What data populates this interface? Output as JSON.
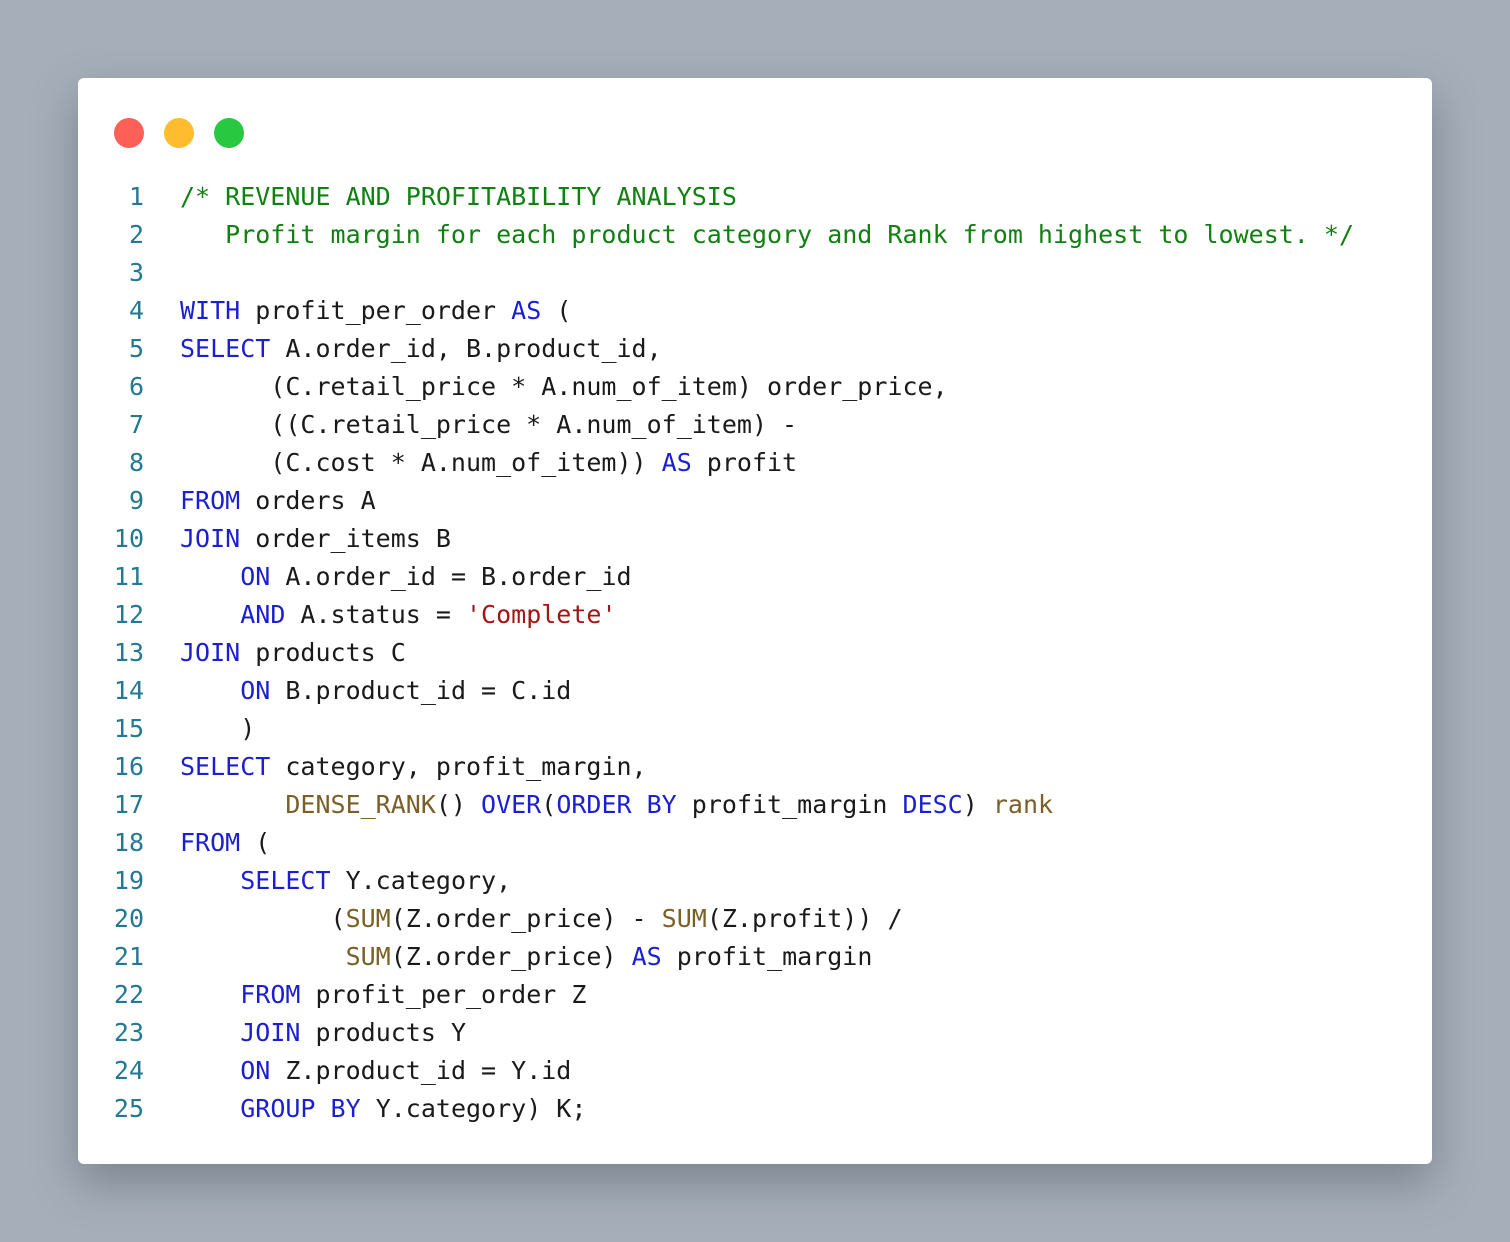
{
  "window": {
    "controls": [
      {
        "name": "close",
        "color": "#fe5f57"
      },
      {
        "name": "minimize",
        "color": "#febc2e"
      },
      {
        "name": "zoom",
        "color": "#28c840"
      }
    ]
  },
  "colors": {
    "background": "#a6afb9",
    "comment": "#108010",
    "keyword": "#1b1fd0",
    "function": "#7a5f27",
    "string": "#a31515",
    "text": "#1a1a1a",
    "line_number": "#237893"
  },
  "code": {
    "lines": [
      {
        "number": "1",
        "tokens": [
          {
            "t": "/* REVENUE AND PROFITABILITY ANALYSIS",
            "k": "com"
          }
        ]
      },
      {
        "number": "2",
        "tokens": [
          {
            "t": "   Profit margin for each product category and Rank from highest to lowest. */",
            "k": "com"
          }
        ]
      },
      {
        "number": "3",
        "tokens": []
      },
      {
        "number": "4",
        "tokens": [
          {
            "t": "WITH",
            "k": "kw"
          },
          {
            "t": " profit_per_order ",
            "k": "txt"
          },
          {
            "t": "AS",
            "k": "kw"
          },
          {
            "t": " (",
            "k": "txt"
          }
        ]
      },
      {
        "number": "5",
        "tokens": [
          {
            "t": "SELECT",
            "k": "kw"
          },
          {
            "t": " A.order_id, B.product_id,",
            "k": "txt"
          }
        ]
      },
      {
        "number": "6",
        "tokens": [
          {
            "t": "      (C.retail_price * A.num_of_item) order_price,",
            "k": "txt"
          }
        ]
      },
      {
        "number": "7",
        "tokens": [
          {
            "t": "      ((C.retail_price * A.num_of_item) -",
            "k": "txt"
          }
        ]
      },
      {
        "number": "8",
        "tokens": [
          {
            "t": "      (C.cost * A.num_of_item)) ",
            "k": "txt"
          },
          {
            "t": "AS",
            "k": "kw"
          },
          {
            "t": " profit",
            "k": "txt"
          }
        ]
      },
      {
        "number": "9",
        "tokens": [
          {
            "t": "FROM",
            "k": "kw"
          },
          {
            "t": " orders A",
            "k": "txt"
          }
        ]
      },
      {
        "number": "10",
        "tokens": [
          {
            "t": "JOIN",
            "k": "kw"
          },
          {
            "t": " order_items B",
            "k": "txt"
          }
        ]
      },
      {
        "number": "11",
        "tokens": [
          {
            "t": "    ",
            "k": "txt"
          },
          {
            "t": "ON",
            "k": "kw"
          },
          {
            "t": " A.order_id = B.order_id",
            "k": "txt"
          }
        ]
      },
      {
        "number": "12",
        "tokens": [
          {
            "t": "    ",
            "k": "txt"
          },
          {
            "t": "AND",
            "k": "kw"
          },
          {
            "t": " A.status = ",
            "k": "txt"
          },
          {
            "t": "'Complete'",
            "k": "str"
          }
        ]
      },
      {
        "number": "13",
        "tokens": [
          {
            "t": "JOIN",
            "k": "kw"
          },
          {
            "t": " products C",
            "k": "txt"
          }
        ]
      },
      {
        "number": "14",
        "tokens": [
          {
            "t": "    ",
            "k": "txt"
          },
          {
            "t": "ON",
            "k": "kw"
          },
          {
            "t": " B.product_id = C.id",
            "k": "txt"
          }
        ]
      },
      {
        "number": "15",
        "tokens": [
          {
            "t": "    )",
            "k": "txt"
          }
        ]
      },
      {
        "number": "16",
        "tokens": [
          {
            "t": "SELECT",
            "k": "kw"
          },
          {
            "t": " category, profit_margin,",
            "k": "txt"
          }
        ]
      },
      {
        "number": "17",
        "tokens": [
          {
            "t": "       ",
            "k": "txt"
          },
          {
            "t": "DENSE_RANK",
            "k": "fn"
          },
          {
            "t": "() ",
            "k": "txt"
          },
          {
            "t": "OVER",
            "k": "kw"
          },
          {
            "t": "(",
            "k": "txt"
          },
          {
            "t": "ORDER BY",
            "k": "kw"
          },
          {
            "t": " profit_margin ",
            "k": "txt"
          },
          {
            "t": "DESC",
            "k": "kw"
          },
          {
            "t": ") ",
            "k": "txt"
          },
          {
            "t": "rank",
            "k": "fn"
          }
        ]
      },
      {
        "number": "18",
        "tokens": [
          {
            "t": "FROM",
            "k": "kw"
          },
          {
            "t": " (",
            "k": "txt"
          }
        ]
      },
      {
        "number": "19",
        "tokens": [
          {
            "t": "    ",
            "k": "txt"
          },
          {
            "t": "SELECT",
            "k": "kw"
          },
          {
            "t": " Y.category,",
            "k": "txt"
          }
        ]
      },
      {
        "number": "20",
        "tokens": [
          {
            "t": "          (",
            "k": "txt"
          },
          {
            "t": "SUM",
            "k": "fn"
          },
          {
            "t": "(Z.order_price) - ",
            "k": "txt"
          },
          {
            "t": "SUM",
            "k": "fn"
          },
          {
            "t": "(Z.profit)) /",
            "k": "txt"
          }
        ]
      },
      {
        "number": "21",
        "tokens": [
          {
            "t": "           ",
            "k": "txt"
          },
          {
            "t": "SUM",
            "k": "fn"
          },
          {
            "t": "(Z.order_price) ",
            "k": "txt"
          },
          {
            "t": "AS",
            "k": "kw"
          },
          {
            "t": " profit_margin",
            "k": "txt"
          }
        ]
      },
      {
        "number": "22",
        "tokens": [
          {
            "t": "    ",
            "k": "txt"
          },
          {
            "t": "FROM",
            "k": "kw"
          },
          {
            "t": " profit_per_order Z",
            "k": "txt"
          }
        ]
      },
      {
        "number": "23",
        "tokens": [
          {
            "t": "    ",
            "k": "txt"
          },
          {
            "t": "JOIN",
            "k": "kw"
          },
          {
            "t": " products Y",
            "k": "txt"
          }
        ]
      },
      {
        "number": "24",
        "tokens": [
          {
            "t": "    ",
            "k": "txt"
          },
          {
            "t": "ON",
            "k": "kw"
          },
          {
            "t": " Z.product_id = Y.id",
            "k": "txt"
          }
        ]
      },
      {
        "number": "25",
        "tokens": [
          {
            "t": "    ",
            "k": "txt"
          },
          {
            "t": "GROUP BY",
            "k": "kw"
          },
          {
            "t": " Y.category) K;",
            "k": "txt"
          }
        ]
      }
    ]
  }
}
